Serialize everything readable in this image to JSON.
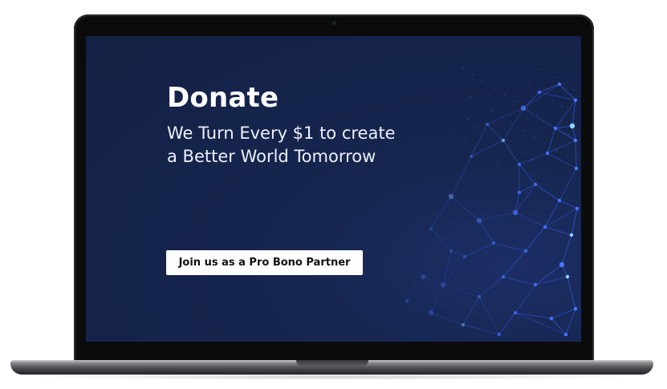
{
  "hero": {
    "title": "Donate",
    "subtitle_line1": "We Turn Every $1 to create",
    "subtitle_line2": "a Better World Tomorrow",
    "cta_label": "Join us as a Pro Bono Partner"
  },
  "colors": {
    "screen_background": "#15234a",
    "network_line": "#2f50c8",
    "network_node": "#4a78ff",
    "button_background": "#ffffff",
    "button_text": "#111111",
    "heading_text": "#ffffff"
  },
  "device": {
    "type": "laptop",
    "graphic": "network-mesh-graphic"
  }
}
